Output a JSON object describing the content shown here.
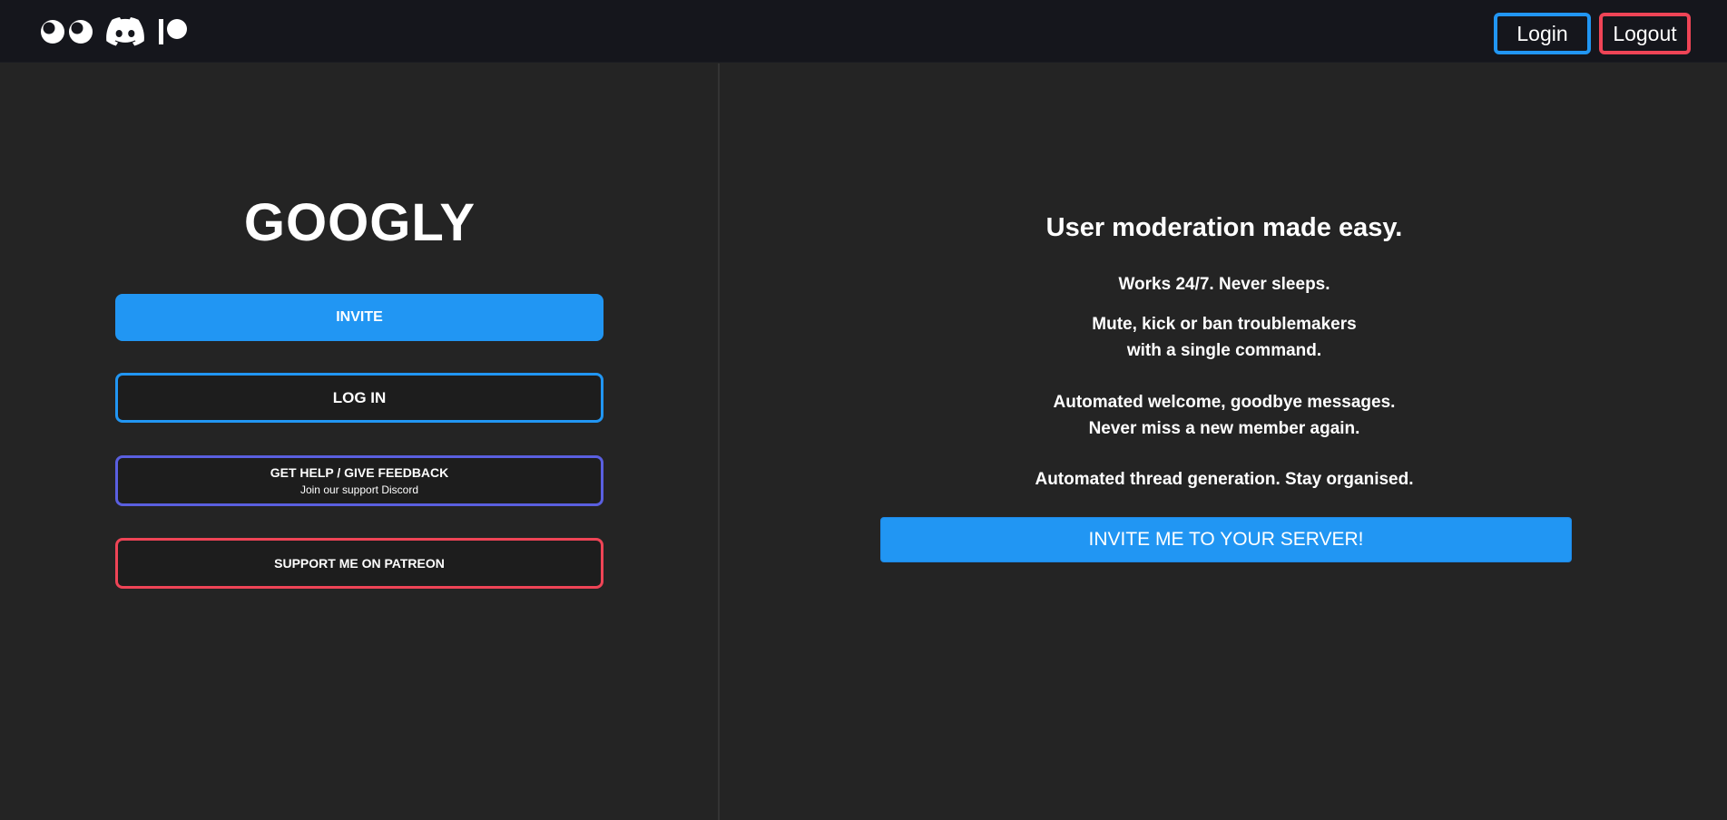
{
  "nav": {
    "icons": [
      "googly-eyes-icon",
      "discord-icon",
      "patreon-icon"
    ],
    "login_label": "Login",
    "logout_label": "Logout"
  },
  "left": {
    "title": "GOOGLY",
    "invite_label": "INVITE",
    "login_label": "LOG IN",
    "help_label": "GET HELP / GIVE FEEDBACK",
    "help_sublabel": "Join our support Discord",
    "patreon_label": "SUPPORT ME ON PATREON"
  },
  "right": {
    "headline": "User moderation made easy.",
    "features": [
      [
        "Works 24/7. Never sleeps."
      ],
      [
        "Mute, kick or ban troublemakers",
        "with a single command."
      ],
      [
        "Automated welcome, goodbye messages.",
        "Never miss a new member again."
      ],
      [
        "Automated thread generation. Stay organised."
      ]
    ],
    "cta_label": "INVITE ME TO YOUR SERVER!"
  },
  "colors": {
    "background": "#242424",
    "topbar": "#15161c",
    "primary_blue": "#2196f3",
    "discord_purple": "#5a5fe0",
    "patreon_red": "#ef4456"
  }
}
